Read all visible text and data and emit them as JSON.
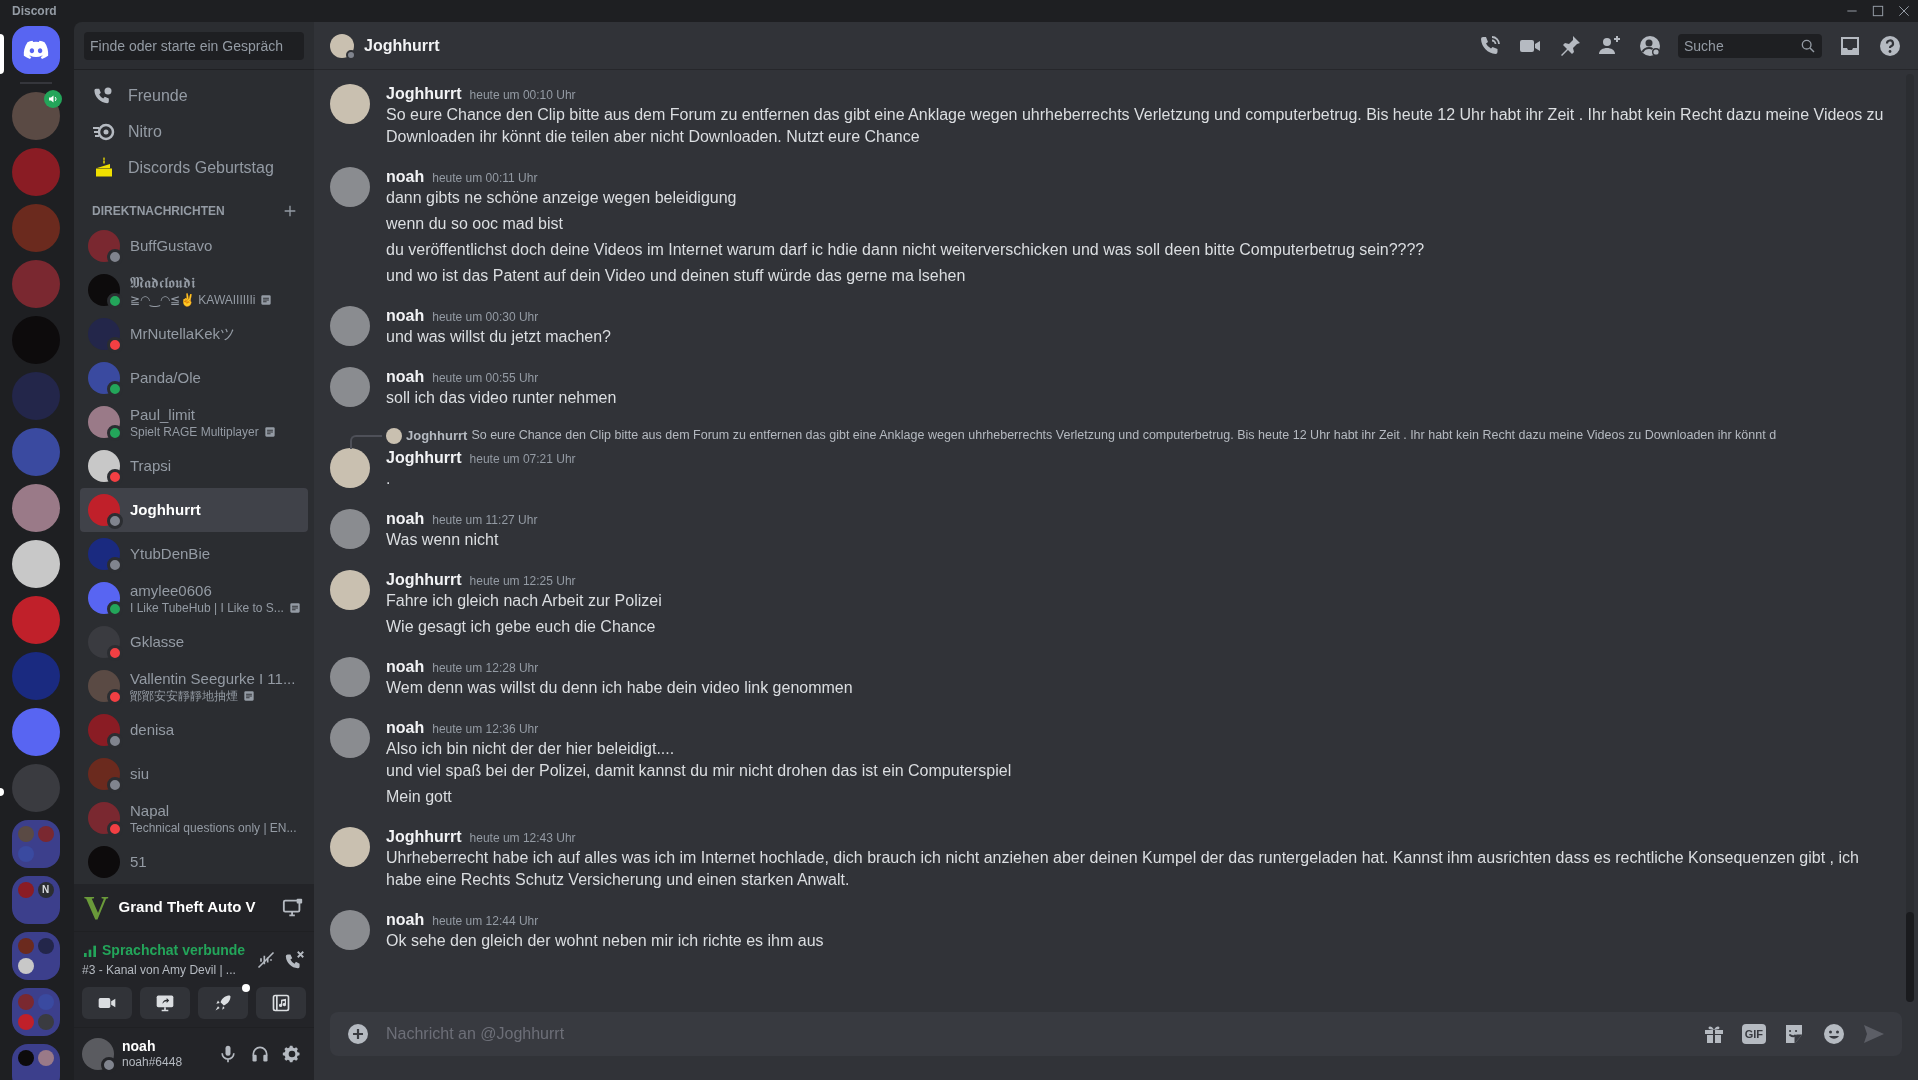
{
  "window": {
    "title": "Discord"
  },
  "servers": [
    {
      "kind": "home",
      "selected": true,
      "unread": false,
      "speaking": false
    },
    {
      "kind": "photo",
      "selected": false,
      "unread": false,
      "speaking": true
    },
    {
      "kind": "photo",
      "selected": false,
      "unread": false,
      "speaking": false
    },
    {
      "kind": "photo",
      "selected": false,
      "unread": false,
      "speaking": false
    },
    {
      "kind": "photo",
      "selected": false,
      "unread": false,
      "speaking": false
    },
    {
      "kind": "photo",
      "selected": false,
      "unread": false,
      "speaking": false
    },
    {
      "kind": "photo",
      "selected": false,
      "unread": false,
      "speaking": false
    },
    {
      "kind": "photo",
      "selected": false,
      "unread": false,
      "speaking": false
    },
    {
      "kind": "photo",
      "selected": false,
      "unread": false,
      "speaking": false
    },
    {
      "kind": "photo",
      "selected": false,
      "unread": false,
      "speaking": false
    },
    {
      "kind": "photo",
      "selected": false,
      "unread": false,
      "speaking": false
    },
    {
      "kind": "photo",
      "selected": false,
      "unread": false,
      "speaking": false
    },
    {
      "kind": "photo",
      "selected": false,
      "unread": false,
      "speaking": false
    },
    {
      "kind": "photo",
      "selected": false,
      "unread": true,
      "speaking": false
    },
    {
      "kind": "folder",
      "selected": false,
      "unread": false,
      "speaking": false,
      "icons": [
        {
          "kind": "photo"
        },
        {
          "kind": "photo"
        },
        {
          "kind": "photo"
        }
      ]
    },
    {
      "kind": "folder",
      "selected": false,
      "unread": false,
      "speaking": false,
      "icons": [
        {
          "kind": "photo"
        },
        {
          "kind": "letters",
          "text": "N"
        }
      ]
    },
    {
      "kind": "folder",
      "selected": false,
      "unread": false,
      "speaking": false,
      "icons": [
        {
          "kind": "photo"
        },
        {
          "kind": "photo"
        },
        {
          "kind": "photo"
        }
      ]
    },
    {
      "kind": "folder",
      "selected": false,
      "unread": false,
      "speaking": false,
      "icons": [
        {
          "kind": "photo"
        },
        {
          "kind": "photo"
        },
        {
          "kind": "photo"
        },
        {
          "kind": "photo"
        }
      ]
    },
    {
      "kind": "folder",
      "selected": false,
      "unread": false,
      "speaking": false,
      "icons": [
        {
          "kind": "photo"
        },
        {
          "kind": "photo"
        }
      ]
    }
  ],
  "sidebar": {
    "search": {
      "placeholder": "Finde oder starte ein Gespräch"
    },
    "nav": [
      {
        "kind": "friends",
        "label": "Freunde"
      },
      {
        "kind": "nitro",
        "label": "Nitro"
      },
      {
        "kind": "cake",
        "label": "Discords Geburtstag"
      }
    ],
    "dm_header": "DIREKTNACHRICHTEN",
    "dms": [
      {
        "name": "BuffGustavo",
        "color": "#80848e",
        "selected": false,
        "note": false
      },
      {
        "name": "𝕸𝖆𝖉𝖈𝖑𝖔𝖚𝖉𝖎",
        "subtitle": "≧◠‿◠≦✌ KAWAIIIIIIi",
        "color": "#23a55a",
        "selected": false,
        "note": true
      },
      {
        "name": "MrNutellaKekツ",
        "color": "#f23f43",
        "selected": false,
        "note": false
      },
      {
        "name": "Panda/Ole",
        "color": "#23a55a",
        "selected": false,
        "note": false
      },
      {
        "name": "Paul_limit",
        "subtitle": "Spielt RAGE Multiplayer",
        "color": "#23a55a",
        "selected": false,
        "note": true
      },
      {
        "name": "Trapsi",
        "color": "#f23f43",
        "selected": false,
        "note": false
      },
      {
        "name": "Joghhurrt",
        "color": "#80848e",
        "selected": true,
        "note": false
      },
      {
        "name": "YtubDenBie",
        "color": "#80848e",
        "selected": false,
        "note": false
      },
      {
        "name": "amylee0606",
        "subtitle": "I Like TubeHub | I Like to S...",
        "color": "#23a55a",
        "selected": false,
        "note": true
      },
      {
        "name": "Gklasse",
        "color": "#f23f43",
        "selected": false,
        "note": false
      },
      {
        "name": "Vallentin Seegurke I 11...",
        "subtitle": "鄮鄮安安靜靜地抽煙",
        "color": "#f23f43",
        "selected": false,
        "note": true
      },
      {
        "name": "denisa",
        "color": "#80848e",
        "selected": false,
        "note": false
      },
      {
        "name": "siu",
        "color": "#80848e",
        "selected": false,
        "note": false
      },
      {
        "name": "Napal",
        "subtitle": "Technical questions only | EN...",
        "color": "#f23f43",
        "selected": false,
        "note": false
      },
      {
        "name": "51",
        "selected": false,
        "note": false
      }
    ],
    "activity": {
      "logo": "V",
      "title": "Grand Theft Auto V"
    },
    "voice": {
      "status": "Sprachchat verbunde",
      "channel": "#3 - Kanal von Amy Devil | ...",
      "buttons": [
        {
          "kind": "camera",
          "dot": false
        },
        {
          "kind": "screen",
          "dot": false
        },
        {
          "kind": "rocket",
          "dot": true
        },
        {
          "kind": "activity",
          "dot": false
        }
      ]
    },
    "user": {
      "name": "noah",
      "tag": "noah#6448",
      "color": "#80848e"
    }
  },
  "chat": {
    "title": "Joghhurrt",
    "search": {
      "placeholder": "Suche"
    },
    "messages": [
      {
        "author": "Joghhurrt",
        "time": "heute um 00:10 Uhr",
        "lines": [
          "So eure Chance den Clip bitte aus dem Forum zu entfernen das gibt eine Anklage wegen uhrheberrechts Verletzung und computerbetrug. Bis heute 12 Uhr habt ihr Zeit . Ihr habt kein Recht dazu meine Videos zu Downloaden ihr könnt die teilen aber nicht Downloaden. Nutzt eure Chance"
        ]
      },
      {
        "author": "noah",
        "time": "heute um 00:11 Uhr",
        "lines": [
          "dann gibts ne schöne anzeige wegen beleidigung",
          "wenn du so ooc mad bist",
          "du veröffentlichst doch deine Videos im Internet warum darf ic hdie dann nicht weiterverschicken und was soll deen bitte Computerbetrug sein????",
          "und wo ist das Patent auf dein Video und deinen stuff würde das gerne ma lsehen"
        ]
      },
      {
        "author": "noah",
        "time": "heute um 00:30 Uhr",
        "lines": [
          "und was willst du jetzt machen?"
        ]
      },
      {
        "author": "noah",
        "time": "heute um 00:55 Uhr",
        "lines": [
          "soll ich das video runter nehmen"
        ]
      },
      {
        "author": "Joghhurrt",
        "time": "heute um 07:21 Uhr",
        "reply": {
          "author": "Joghhurrt",
          "text": "So eure Chance den Clip bitte aus dem Forum zu entfernen das gibt eine Anklage wegen uhrheberrechts Verletzung und computerbetrug. Bis heute 12 Uhr habt ihr Zeit . Ihr habt kein Recht dazu meine Videos zu Downloaden ihr könnt d"
        },
        "lines": [
          "."
        ]
      },
      {
        "author": "noah",
        "time": "heute um 11:27 Uhr",
        "lines": [
          "Was wenn nicht"
        ]
      },
      {
        "author": "Joghhurrt",
        "time": "heute um 12:25 Uhr",
        "lines": [
          "Fahre ich gleich nach Arbeit zur Polizei",
          "Wie gesagt ich gebe euch die Chance"
        ]
      },
      {
        "author": "noah",
        "time": "heute um 12:28 Uhr",
        "lines": [
          "Wem denn was willst du denn ich habe dein video link genommen"
        ]
      },
      {
        "author": "noah",
        "time": "heute um 12:36 Uhr",
        "lines": [
          "Also ich bin nicht der der hier beleidigt....\nund viel spaß bei der Polizei, damit kannst du mir nicht drohen das ist ein Computerspiel",
          "Mein gott"
        ]
      },
      {
        "author": "Joghhurrt",
        "time": "heute um 12:43 Uhr",
        "lines": [
          "Uhrheberrecht habe ich auf alles was ich im Internet hochlade, dich brauch ich nicht anziehen aber deinen Kumpel der das runtergeladen hat. Kannst ihm ausrichten dass es rechtliche Konsequenzen gibt , ich habe eine Rechts Schutz Versicherung und einen starken Anwalt."
        ]
      },
      {
        "author": "noah",
        "time": "heute um 12:44 Uhr",
        "lines": [
          "Ok sehe den gleich der wohnt neben mir ich richte es ihm aus"
        ]
      }
    ],
    "composer": {
      "placeholder": "Nachricht an @Joghhurrt",
      "gif_label": "GIF"
    }
  }
}
